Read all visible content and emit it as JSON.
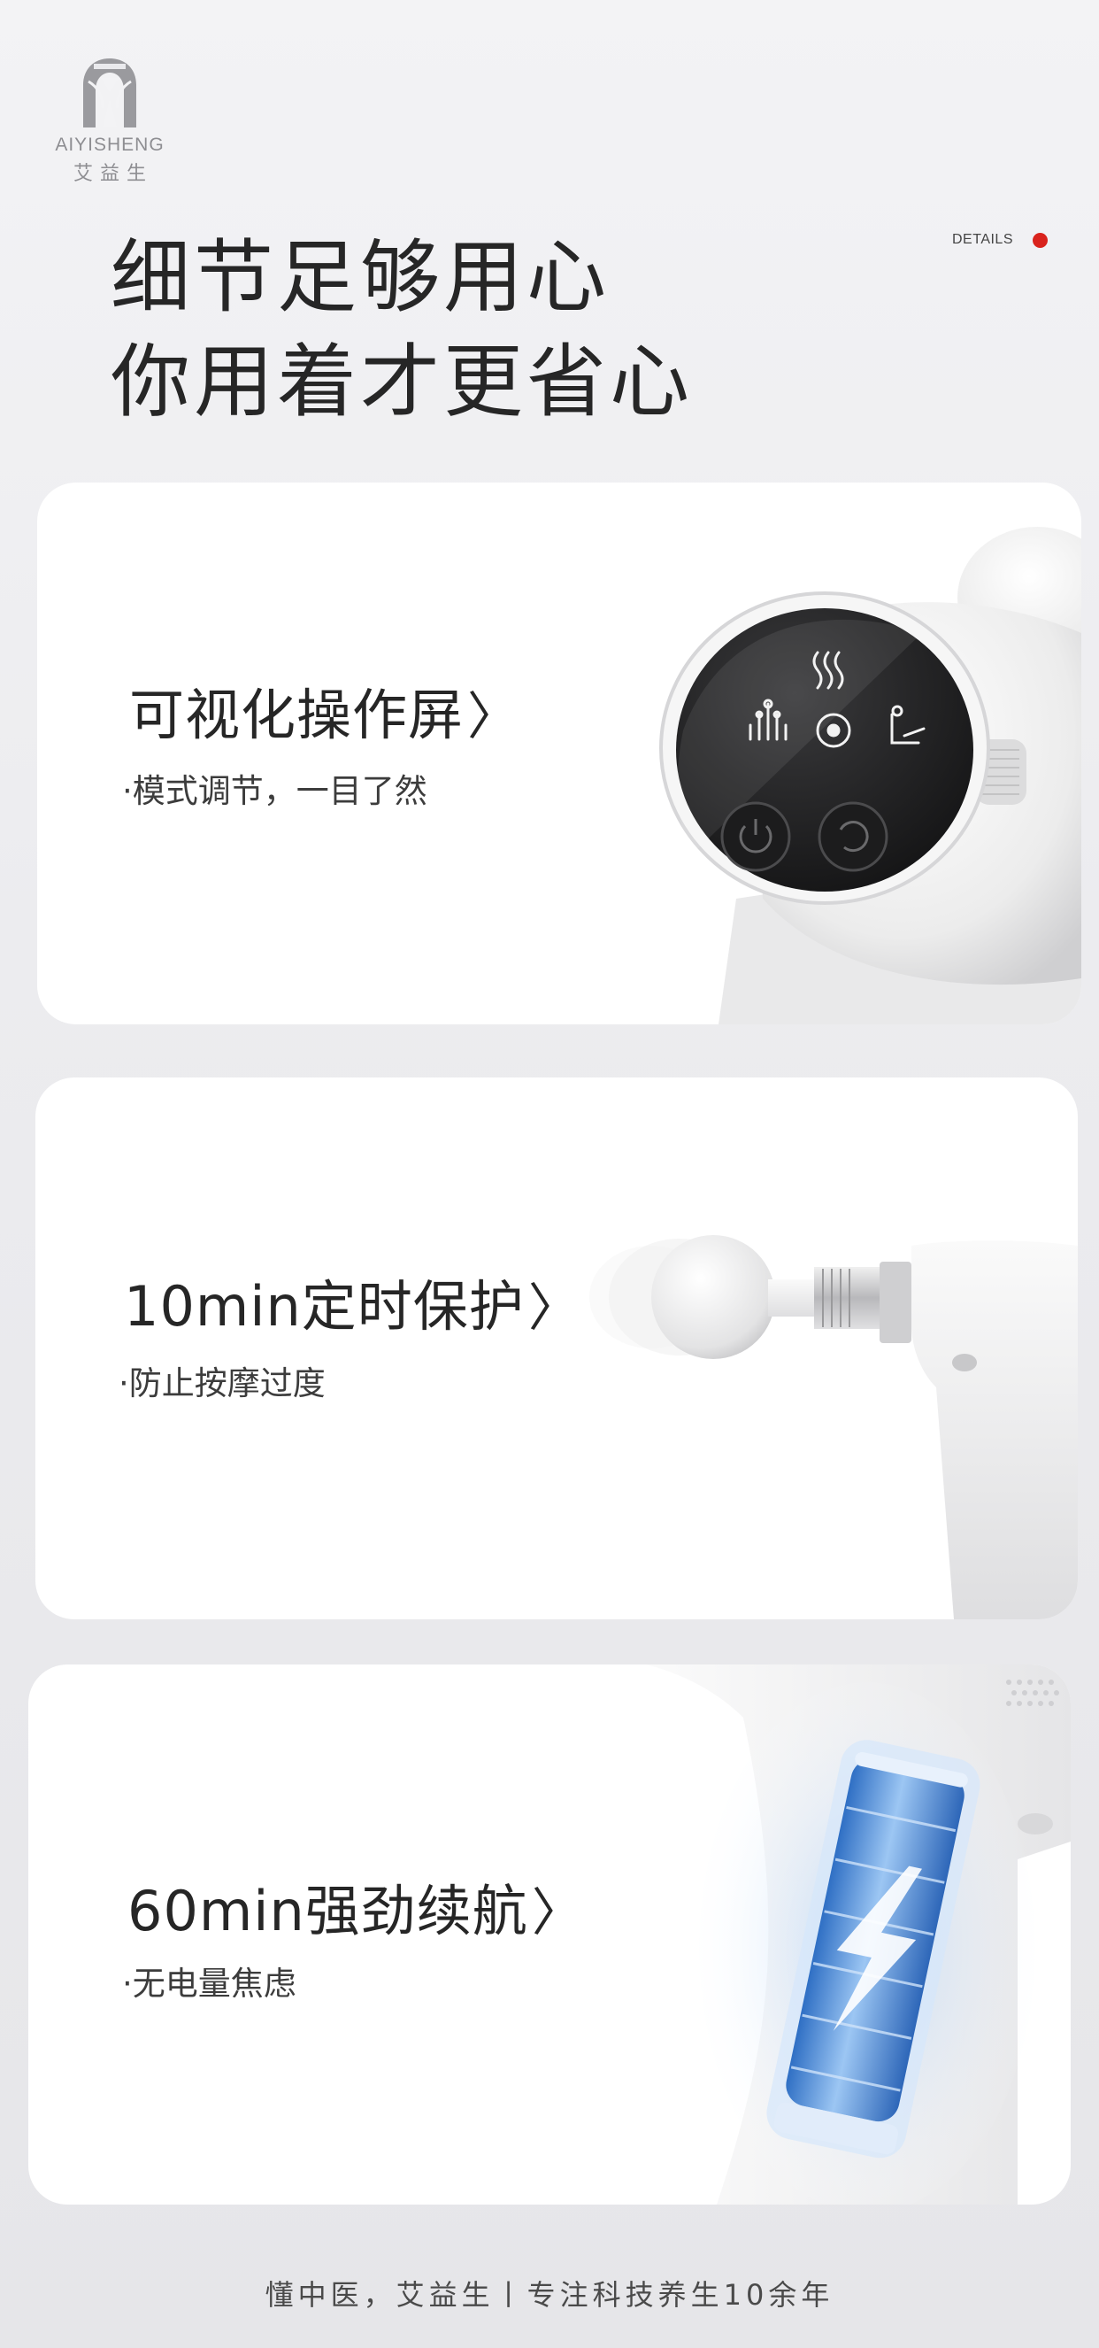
{
  "brand": {
    "name_en": "AIYISHENG",
    "name_cn": "艾益生"
  },
  "details_label": "DETAILS",
  "headline": {
    "line1": "细节足够用心",
    "line2": "你用着才更省心"
  },
  "cards": [
    {
      "title": "可视化操作屏",
      "arrow": "〉",
      "subtitle": "·模式调节，一目了然"
    },
    {
      "title": "10min定时保护",
      "arrow": "〉",
      "subtitle": "·防止按摩过度"
    },
    {
      "title": "60min强劲续航",
      "arrow": "〉",
      "subtitle": "·无电量焦虑"
    }
  ],
  "footer": "懂中医，艾益生丨专注科技养生10余年",
  "colors": {
    "accent_dot": "#d9231d",
    "card_bg": "#ffffff",
    "page_bg": "#ececef",
    "battery_blue": "#3a7bd5"
  }
}
